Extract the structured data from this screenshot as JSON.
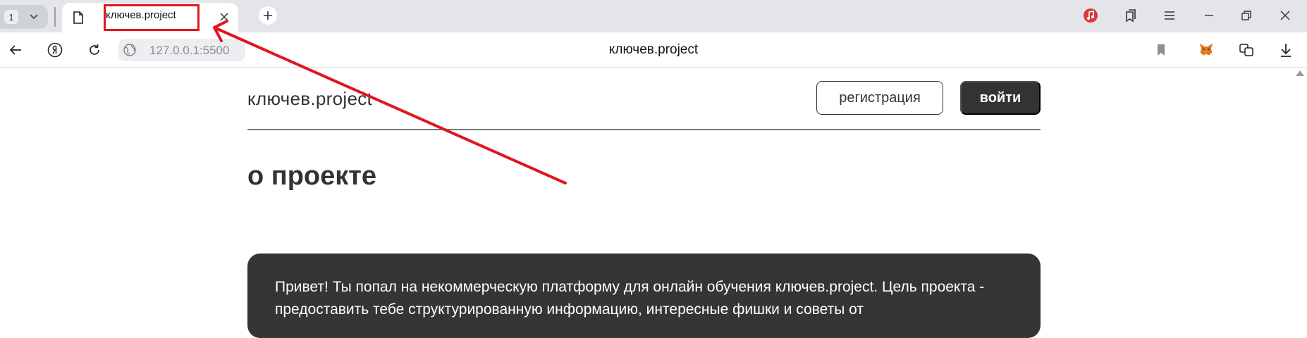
{
  "browser": {
    "tab_count": "1",
    "tab_title": "ключев.project",
    "address_url": "127.0.0.1:5500",
    "page_title": "ключев.project"
  },
  "site": {
    "logo": "ключев.project",
    "register_label": "регистрация",
    "login_label": "войти",
    "heading": "о проекте",
    "intro_text": "Привет! Ты попал на некоммерческую платформу для онлайн обучения ключев.project. Цель проекта - предоставить тебе структурированную информацию, интересные фишки и советы от"
  },
  "colors": {
    "annotation": "#e0161f",
    "dark": "#333333",
    "card": "#353535"
  }
}
